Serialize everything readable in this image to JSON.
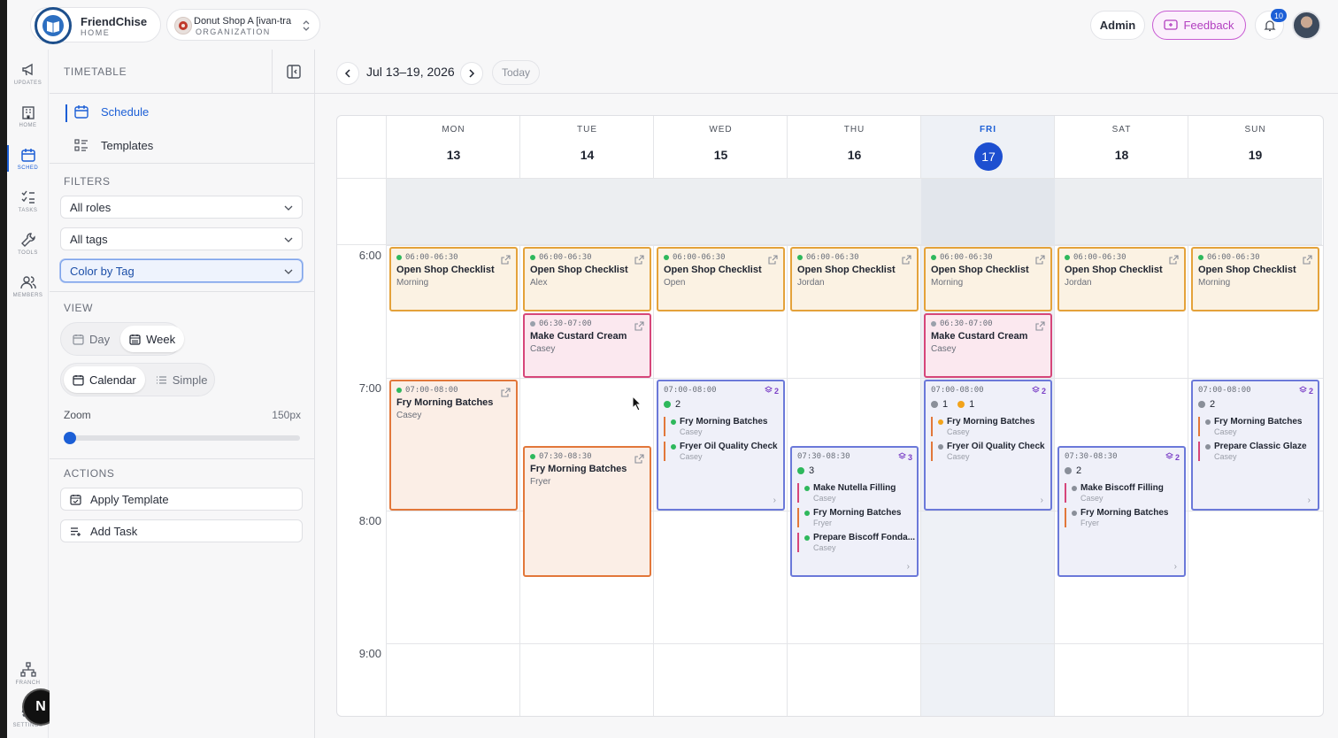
{
  "brand": {
    "name": "FriendChise",
    "sub": "HOME"
  },
  "org": {
    "name": "Donut Shop A [ivan-tra",
    "sub": "ORGANIZATION"
  },
  "topbar": {
    "admin": "Admin",
    "feedback": "Feedback",
    "notif_count": "10",
    "accent": "#1c5fd6",
    "feedback_color": "#b23fc0"
  },
  "rail": {
    "items": [
      {
        "label": "UPDATES",
        "icon": "megaphone-icon"
      },
      {
        "label": "HOME",
        "icon": "building-icon"
      },
      {
        "label": "SCHED",
        "icon": "calendar-icon"
      },
      {
        "label": "TASKS",
        "icon": "checklist-icon"
      },
      {
        "label": "TOOLS",
        "icon": "wrench-icon"
      },
      {
        "label": "MEMBERS",
        "icon": "users-icon"
      },
      {
        "label": "FRANCH",
        "icon": "network-icon"
      },
      {
        "label": "SETTINGS",
        "icon": "gear-icon"
      }
    ],
    "badge": "N"
  },
  "panel": {
    "title": "TIMETABLE",
    "nav": [
      {
        "label": "Schedule"
      },
      {
        "label": "Templates"
      }
    ],
    "filters_label": "FILTERS",
    "filters": {
      "roles": "All roles",
      "tags": "All tags",
      "color": "Color by Tag"
    },
    "view_label": "VIEW",
    "view": {
      "day": "Day",
      "week": "Week",
      "calendar": "Calendar",
      "simple": "Simple"
    },
    "zoom": {
      "label": "Zoom",
      "value": "150px",
      "level": 0
    },
    "actions_label": "ACTIONS",
    "actions": {
      "apply": "Apply Template",
      "add": "Add Task"
    }
  },
  "datebar": {
    "range": "Jul 13–19, 2026",
    "today": "Today"
  },
  "calendar": {
    "days": [
      {
        "dow": "MON",
        "num": "13"
      },
      {
        "dow": "TUE",
        "num": "14"
      },
      {
        "dow": "WED",
        "num": "15"
      },
      {
        "dow": "THU",
        "num": "16"
      },
      {
        "dow": "FRI",
        "num": "17",
        "today": true
      },
      {
        "dow": "SAT",
        "num": "18"
      },
      {
        "dow": "SUN",
        "num": "19"
      }
    ],
    "hours": [
      "6:00",
      "7:00",
      "8:00",
      "9:00"
    ],
    "events": [
      {
        "day": 0,
        "start": "6:00",
        "end": "6:30",
        "time": "06:00-06:30",
        "title": "Open Shop Checklist",
        "sub": "Morning",
        "color": "or"
      },
      {
        "day": 1,
        "start": "6:00",
        "end": "6:30",
        "time": "06:00-06:30",
        "title": "Open Shop Checklist",
        "sub": "Alex",
        "color": "or"
      },
      {
        "day": 2,
        "start": "6:00",
        "end": "6:30",
        "time": "06:00-06:30",
        "title": "Open Shop Checklist",
        "sub": "Open",
        "color": "or"
      },
      {
        "day": 3,
        "start": "6:00",
        "end": "6:30",
        "time": "06:00-06:30",
        "title": "Open Shop Checklist",
        "sub": "Jordan",
        "color": "or"
      },
      {
        "day": 4,
        "start": "6:00",
        "end": "6:30",
        "time": "06:00-06:30",
        "title": "Open Shop Checklist",
        "sub": "Morning",
        "color": "or"
      },
      {
        "day": 5,
        "start": "6:00",
        "end": "6:30",
        "time": "06:00-06:30",
        "title": "Open Shop Checklist",
        "sub": "Jordan",
        "color": "or"
      },
      {
        "day": 6,
        "start": "6:00",
        "end": "6:30",
        "time": "06:00-06:30",
        "title": "Open Shop Checklist",
        "sub": "Morning",
        "color": "or"
      },
      {
        "day": 1,
        "start": "6:30",
        "end": "7:00",
        "time": "06:30-07:00",
        "title": "Make Custard Cream",
        "sub": "Casey",
        "color": "pk",
        "dot": "#9aa0ab"
      },
      {
        "day": 4,
        "start": "6:30",
        "end": "7:00",
        "time": "06:30-07:00",
        "title": "Make Custard Cream",
        "sub": "Casey",
        "color": "pk",
        "dot": "#9aa0ab"
      },
      {
        "day": 0,
        "start": "7:00",
        "end": "8:00",
        "time": "07:00-08:00",
        "title": "Fry Morning Batches",
        "sub": "Casey",
        "color": "rd"
      },
      {
        "day": 1,
        "start": "7:30",
        "end": "8:30",
        "time": "07:30-08:30",
        "title": "Fry Morning Batches",
        "sub": "Fryer",
        "color": "rd"
      }
    ],
    "groups": [
      {
        "day": 2,
        "start": "7:00",
        "end": "8:00",
        "time": "07:00-08:00",
        "count": "2",
        "stats": [
          {
            "n": "2",
            "c": "#2eb85c"
          }
        ],
        "items": [
          {
            "title": "Fry Morning Batches",
            "sub": "Casey",
            "c": "#2eb85c",
            "bar": "#e2773a"
          },
          {
            "title": "Fryer Oil Quality Check",
            "sub": "Casey",
            "c": "#2eb85c",
            "bar": "#e2773a"
          }
        ],
        "more": true
      },
      {
        "day": 3,
        "start": "7:30",
        "end": "8:30",
        "time": "07:30-08:30",
        "count": "3",
        "stats": [
          {
            "n": "3",
            "c": "#2eb85c"
          }
        ],
        "items": [
          {
            "title": "Make Nutella Filling",
            "sub": "Casey",
            "c": "#2eb85c",
            "bar": "#d6467a"
          },
          {
            "title": "Fry Morning Batches",
            "sub": "Fryer",
            "c": "#2eb85c",
            "bar": "#e2773a"
          },
          {
            "title": "Prepare Biscoff Fonda...",
            "sub": "Casey",
            "c": "#2eb85c",
            "bar": "#d6467a"
          }
        ],
        "more": true
      },
      {
        "day": 4,
        "start": "7:00",
        "end": "8:00",
        "time": "07:00-08:00",
        "count": "2",
        "stats": [
          {
            "n": "1",
            "c": "#8a8f99"
          },
          {
            "n": "1",
            "c": "#f2a31b"
          }
        ],
        "items": [
          {
            "title": "Fry Morning Batches",
            "sub": "Casey",
            "c": "#f2a31b",
            "bar": "#e2773a"
          },
          {
            "title": "Fryer Oil Quality Check",
            "sub": "Casey",
            "c": "#8a8f99",
            "bar": "#e2773a"
          }
        ],
        "more": true
      },
      {
        "day": 5,
        "start": "7:30",
        "end": "8:30",
        "time": "07:30-08:30",
        "count": "2",
        "stats": [
          {
            "n": "2",
            "c": "#8a8f99"
          }
        ],
        "items": [
          {
            "title": "Make Biscoff Filling",
            "sub": "Casey",
            "c": "#8a8f99",
            "bar": "#d6467a"
          },
          {
            "title": "Fry Morning Batches",
            "sub": "Fryer",
            "c": "#8a8f99",
            "bar": "#e2773a"
          }
        ],
        "more": true
      },
      {
        "day": 6,
        "start": "7:00",
        "end": "8:00",
        "time": "07:00-08:00",
        "count": "2",
        "stats": [
          {
            "n": "2",
            "c": "#8a8f99"
          }
        ],
        "items": [
          {
            "title": "Fry Morning Batches",
            "sub": "Casey",
            "c": "#8a8f99",
            "bar": "#e2773a"
          },
          {
            "title": "Prepare Classic Glaze",
            "sub": "Casey",
            "c": "#8a8f99",
            "bar": "#d6467a"
          }
        ],
        "more": true
      }
    ]
  }
}
